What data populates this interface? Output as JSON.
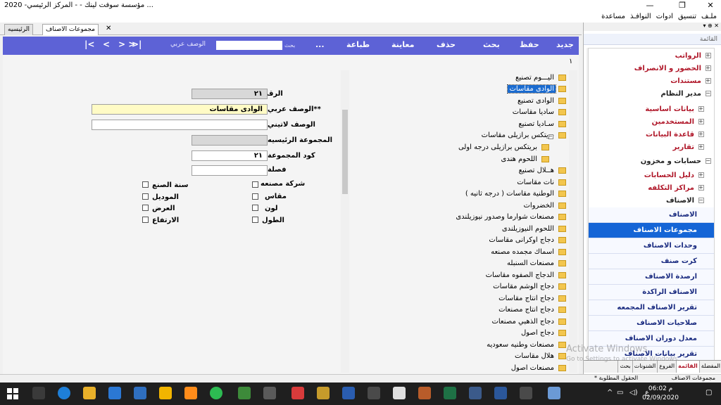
{
  "window": {
    "title": "مؤسسة سوفت لينك  -  - المركز الرئيسي- 2020 ..."
  },
  "menu": [
    "ملـف",
    "تنسيق",
    "ادوات",
    "النوافـذ",
    "مساعدة"
  ],
  "doc_tabs": [
    "الرئيسيه",
    "مجموعات الاصناف"
  ],
  "toolbar": {
    "buttons": [
      "جديد",
      "حفظ",
      "بحث",
      "حذف",
      "معاينة",
      "طباعة",
      "..."
    ],
    "search_label": "بحث",
    "search_field_label": "الوصف عربي",
    "nav": [
      ">|",
      "> >",
      "<",
      "|<"
    ]
  },
  "page_number": "١",
  "tree_items": [
    "اليـــوم تصنيع",
    "الوادى مقاسات",
    "الوادى تصنيع",
    "ساديا مقاسات",
    "سـاديا تصنيع",
    "بريتكس برازيلى مقاسات",
    "بريتكس برازيلى درجه اولى",
    "اللحوم هندى",
    "هــلال تصنيع",
    "نات مقاسات",
    "الوطنية مقاسات ( درجه ثانيه )",
    "الخضروات",
    "مصنعات شوارما وصدور نيوزيلندى",
    "اللحوم النيوزيلندى",
    "دجاج اوكرانى مقاسات",
    "اسماك مجمده مصنعه",
    "مصنعات السنبله",
    "الدجاج الصفوه مقاسات",
    "دجاج الوشم مقاسات",
    "دجاج انتاج مقاسات",
    "دجاج انتاج مصنعات",
    "دجاج الذهبي مصنعات",
    "دجاج اصول",
    "مصنعات وطنيه سعوديه",
    "هلال مقاسات",
    "مصنعات اصول"
  ],
  "form": {
    "number_label": "الرقم",
    "number_value": "٢١",
    "desc_ar_label": "**الوصف عربي",
    "desc_ar_value": "الوادى مقاسات",
    "desc_en_label": "الوصف لاتيني",
    "desc_en_value": "",
    "main_group_label": "المجموعة الرئيسيه",
    "main_group_value": "",
    "group_code_label": "كود المجموعة",
    "group_code_value": "٢١",
    "category_label": "فصلة",
    "category_value": "",
    "checkboxes_right": [
      "شركة مصنعه",
      "مقاس",
      "لون",
      "الطول"
    ],
    "checkboxes_left": [
      "سنة الصنع",
      "الموديل",
      "العرض",
      "الارتفاع"
    ]
  },
  "panel": {
    "title": "القائمة",
    "items": [
      {
        "label": "الرواتب",
        "type": "plus",
        "style": "red"
      },
      {
        "label": "الحضور و الانصراف",
        "type": "plus",
        "style": "red"
      },
      {
        "label": "مستندات",
        "type": "plus",
        "style": "red"
      },
      {
        "label": "مدير النظام",
        "type": "minus",
        "style": "dark"
      },
      {
        "label": "بيانات اساسية",
        "type": "plus",
        "style": "red"
      },
      {
        "label": "المستخدمين",
        "type": "plus",
        "style": "red"
      },
      {
        "label": "قاعدة البيانات",
        "type": "plus",
        "style": "red"
      },
      {
        "label": "تقارير",
        "type": "plus",
        "style": "red"
      },
      {
        "label": "حسابات و مخزون",
        "type": "minus",
        "style": "dark"
      },
      {
        "label": "دليل الحسابات",
        "type": "plus",
        "style": "red"
      },
      {
        "label": "مراكز التكلفه",
        "type": "plus",
        "style": "red"
      },
      {
        "label": "الاصناف",
        "type": "minus",
        "style": "dark"
      }
    ],
    "leaves": [
      "الاصناف",
      "مجموعات الاصناف",
      "وحدات الاصناف",
      "كرت صنف",
      "ارصدة الاصناف",
      "الاصناف الراكدة",
      "تقرير الاصناف المجمعه",
      "صلاحيات الاصناف",
      "معدل دوران الاصناف",
      "تقرير بيانات الاصناف"
    ],
    "active_leaf": 1,
    "bottom_tabs": [
      "المفضلة",
      "القائمة",
      "الفروع",
      "الشنونات",
      "بحث"
    ]
  },
  "status": {
    "left_text": "مجموعات الاصناف",
    "mid_text": "* الحقول المطلوبة"
  },
  "watermark": {
    "line1": "Activate Windows",
    "line2": "Go to Settings to activate Windows."
  },
  "taskbar": {
    "time": "06:02 م",
    "date": "02/09/2020",
    "lang": "ع"
  },
  "colors": {
    "toolbar": "#5d62d6",
    "selection": "#1a6bd0",
    "menu_red": "#b0182a",
    "required_field": "#fffbc5"
  }
}
